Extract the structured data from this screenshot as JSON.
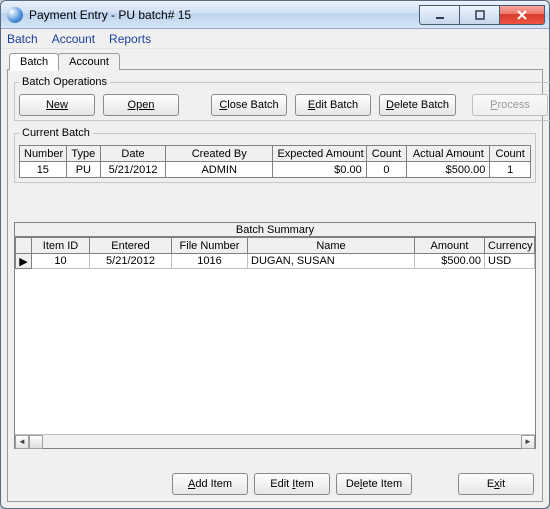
{
  "window": {
    "title": "Payment Entry - PU batch# 15"
  },
  "menubar": {
    "items": [
      "Batch",
      "Account",
      "Reports"
    ]
  },
  "tabs": {
    "items": [
      {
        "label": "Batch",
        "active": true
      },
      {
        "label": "Account",
        "active": false
      }
    ]
  },
  "batch_ops": {
    "legend": "Batch Operations",
    "new": "New",
    "open": "Open",
    "close_batch": "Close Batch",
    "edit_batch": "Edit Batch",
    "delete_batch": "Delete Batch",
    "process": "Process"
  },
  "current_batch": {
    "legend": "Current Batch",
    "headers": {
      "number": "Number",
      "type": "Type",
      "date": "Date",
      "created_by": "Created By",
      "expected_amount": "Expected Amount",
      "count1": "Count",
      "actual_amount": "Actual Amount",
      "count2": "Count"
    },
    "row": {
      "number": "15",
      "type": "PU",
      "date": "5/21/2012",
      "created_by": "ADMIN",
      "expected_amount": "$0.00",
      "count1": "0",
      "actual_amount": "$500.00",
      "count2": "1"
    }
  },
  "grid": {
    "title": "Batch Summary",
    "headers": {
      "row": "",
      "item_id": "Item ID",
      "entered": "Entered",
      "file_number": "File Number",
      "name": "Name",
      "amount": "Amount",
      "currency": "Currency"
    },
    "rows": [
      {
        "marker": "▶",
        "item_id": "10",
        "entered": "5/21/2012",
        "file_number": "1016",
        "name": "DUGAN, SUSAN",
        "amount": "$500.00",
        "currency": "USD"
      }
    ]
  },
  "bottom": {
    "add_item": "Add Item",
    "edit_item": "Edit Item",
    "delete_item": "Delete Item",
    "exit": "Exit"
  }
}
